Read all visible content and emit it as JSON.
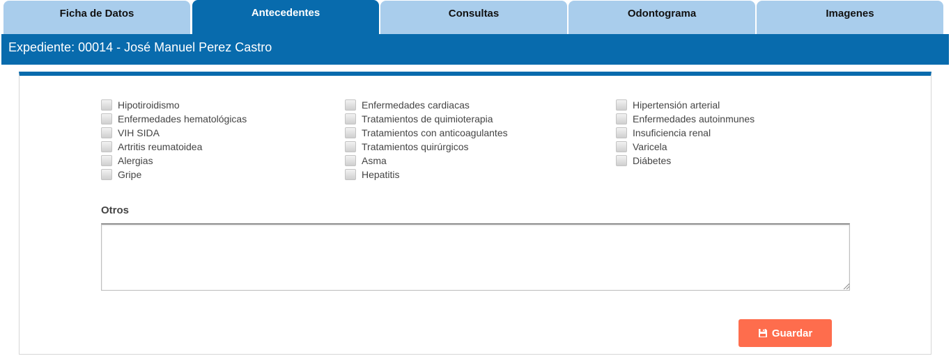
{
  "tabs": [
    {
      "label": "Ficha de Datos",
      "active": false
    },
    {
      "label": "Antecedentes",
      "active": true
    },
    {
      "label": "Consultas",
      "active": false
    },
    {
      "label": "Odontograma",
      "active": false
    },
    {
      "label": "Imagenes",
      "active": false
    }
  ],
  "header": {
    "title": "Expediente: 00014 - José Manuel Perez Castro"
  },
  "conditions": {
    "col1": [
      "Hipotiroidismo",
      "Enfermedades hematológicas",
      "VIH SIDA",
      "Artritis reumatoidea",
      "Alergias",
      "Gripe"
    ],
    "col2": [
      "Enfermedades cardiacas",
      "Tratamientos de quimioterapia",
      "Tratamientos con anticoagulantes",
      "Tratamientos quirúrgicos",
      "Asma",
      "Hepatitis"
    ],
    "col3": [
      "Hipertensión arterial",
      "Enfermedades autoinmunes",
      "Insuficiencia renal",
      "Varicela",
      "Diábetes"
    ]
  },
  "otros": {
    "label": "Otros",
    "value": ""
  },
  "save_button": {
    "label": "Guardar",
    "icon": "floppy-disk-icon"
  },
  "colors": {
    "primary": "#086bad",
    "tab_inactive": "#a9cdec",
    "accent": "#fe6d4d"
  }
}
